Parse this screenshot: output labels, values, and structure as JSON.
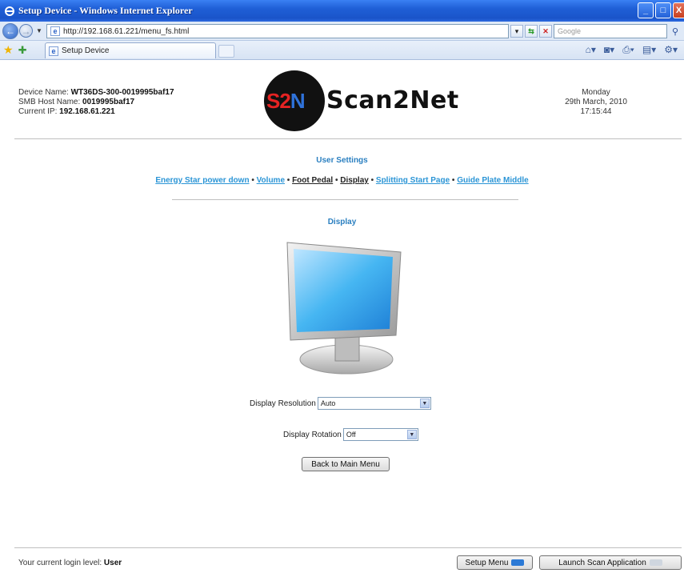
{
  "window": {
    "title": "Setup Device - Windows Internet Explorer",
    "buttons": [
      "_",
      "□",
      "X"
    ]
  },
  "addressbar": {
    "url": "http://192.168.61.221/menu_fs.html",
    "search_placeholder": "Google"
  },
  "tabbar": {
    "tab_title": "Setup Device"
  },
  "device": {
    "name_label": "Device Name: ",
    "name_value": "WT36DS-300-0019995baf17",
    "smb_label": "SMB Host Name: ",
    "smb_value": "0019995baf17",
    "ip_label": "Current IP: ",
    "ip_value": "192.168.61.221"
  },
  "logo": {
    "mark_s": "S",
    "mark_2": "2",
    "mark_n": "N",
    "word": "Scan2Net"
  },
  "datetime": {
    "day": "Monday",
    "date": "29th March, 2010",
    "time": "17:15:44"
  },
  "main": {
    "section_title": "User Settings",
    "sep": " • ",
    "links": [
      {
        "label": "Energy Star power down",
        "active": false
      },
      {
        "label": "Volume",
        "active": false
      },
      {
        "label": "Foot Pedal",
        "active": true
      },
      {
        "label": "Display",
        "active": true
      },
      {
        "label": "Splitting Start Page",
        "active": false
      },
      {
        "label": "Guide Plate Middle",
        "active": false
      }
    ],
    "subsection_title": "Display",
    "resolution_label": "Display Resolution",
    "resolution_value": "Auto",
    "rotation_label": "Display Rotation",
    "rotation_value": "Off",
    "back_button": "Back to Main Menu"
  },
  "footer": {
    "login_label": "Your current login level: ",
    "login_value": "User",
    "setup_menu_button": "Setup Menu",
    "launch_button": "Launch Scan Application"
  }
}
